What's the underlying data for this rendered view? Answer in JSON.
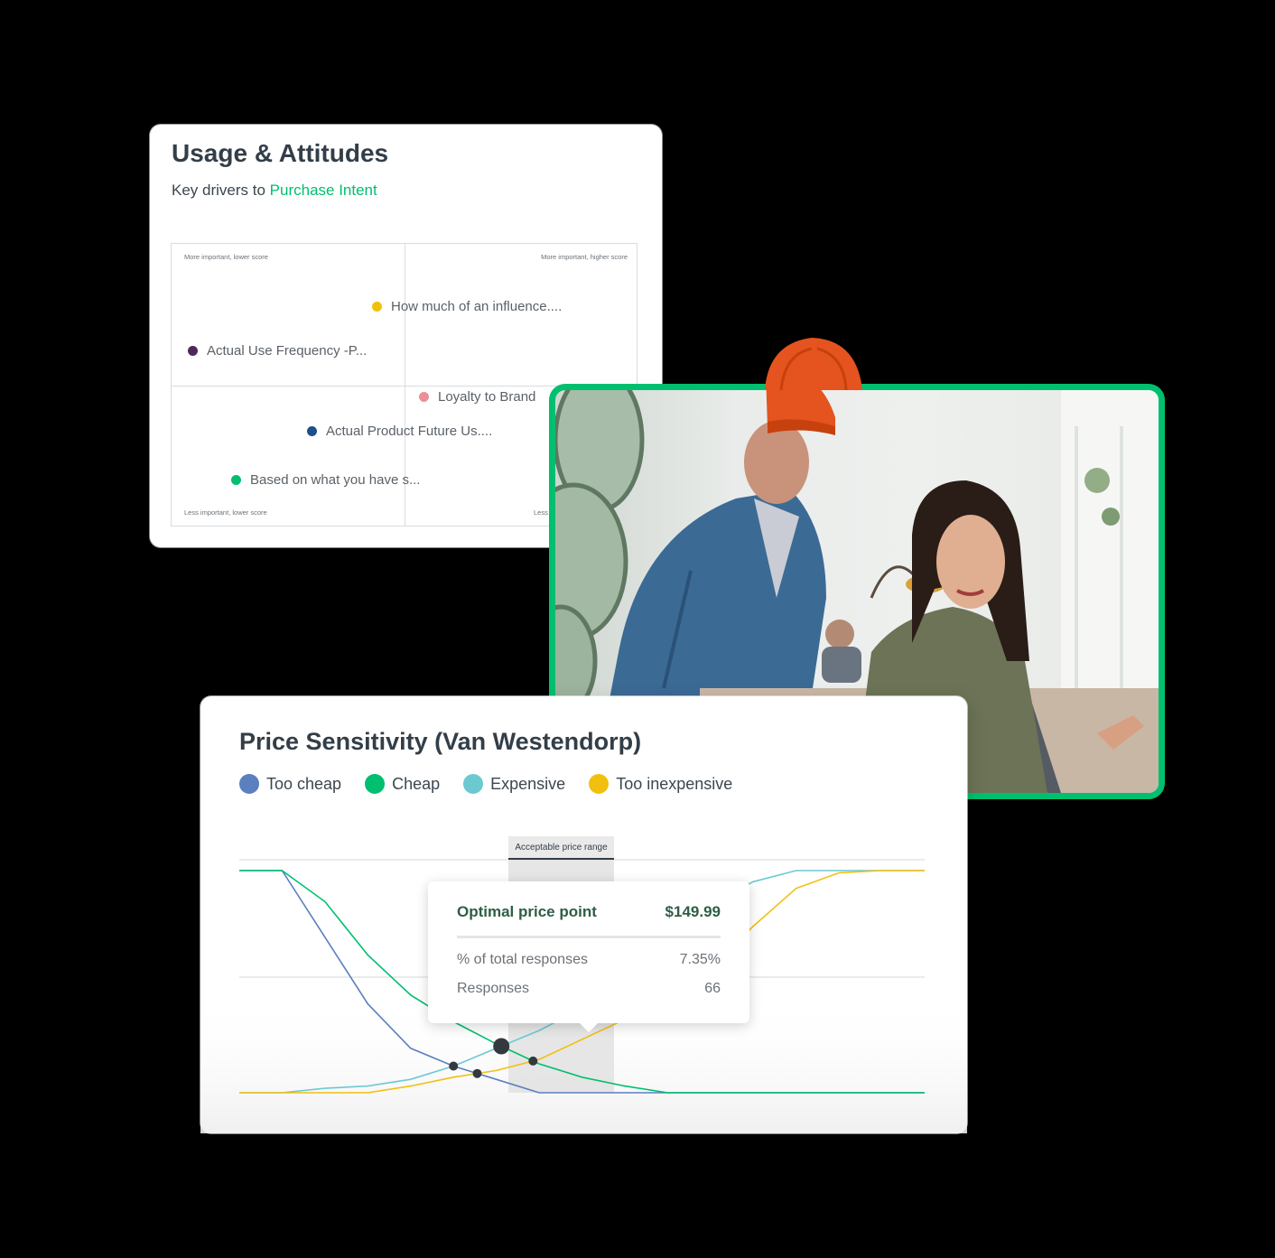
{
  "usage_card": {
    "title": "Usage & Attitudes",
    "subtitle_prefix": "Key drivers to ",
    "subtitle_highlight": "Purchase Intent",
    "corners": {
      "top_left": "More important, lower score",
      "top_right": "More important, higher score",
      "bottom_left": "Less important, lower score",
      "bottom_right": "Less"
    },
    "points": [
      {
        "label": "How much of an influence....",
        "color": "#f1c00f"
      },
      {
        "label": "Actual Use Frequency -P...",
        "color": "#4b2a5a"
      },
      {
        "label": "Loyalty to Brand",
        "color": "#ec8f98"
      },
      {
        "label": "Actual Product Future Us....",
        "color": "#1f4e8a"
      },
      {
        "label": "Based on what you have s...",
        "color": "#00bf6f"
      }
    ]
  },
  "photo": {
    "description_icon": "photo-two-people-laptop",
    "accent_border": "#00bf6f"
  },
  "price_card": {
    "title": "Price Sensitivity (Van Westendorp)",
    "range_label": "Acceptable price range",
    "tooltip": {
      "title": "Optimal price point",
      "price": "$149.99",
      "rows": [
        {
          "label": "% of total responses",
          "value": "7.35%"
        },
        {
          "label": "Responses",
          "value": "66"
        }
      ]
    }
  },
  "chart_data": {
    "type": "line",
    "title": "Price Sensitivity (Van Westendorp)",
    "legend_placement": "top-left",
    "grid": true,
    "ylim": [
      0,
      1
    ],
    "x": [
      0,
      1,
      2,
      3,
      4,
      5,
      6,
      7,
      8,
      9,
      10,
      11,
      12,
      13,
      14,
      15,
      16
    ],
    "series": [
      {
        "name": "Too cheap",
        "color": "#5b7fbf",
        "values": [
          1.0,
          1.0,
          0.7,
          0.4,
          0.2,
          0.12,
          0.06,
          0.0,
          0.0,
          0.0,
          0.0,
          0.0,
          0.0,
          0.0,
          0.0,
          0.0,
          0.0
        ]
      },
      {
        "name": "Cheap",
        "color": "#00bf6f",
        "values": [
          1.0,
          1.0,
          0.86,
          0.62,
          0.44,
          0.32,
          0.22,
          0.13,
          0.07,
          0.03,
          0.0,
          0.0,
          0.0,
          0.0,
          0.0,
          0.0,
          0.0
        ]
      },
      {
        "name": "Expensive",
        "color": "#6cc9d1",
        "values": [
          0.0,
          0.0,
          0.02,
          0.03,
          0.06,
          0.12,
          0.2,
          0.28,
          0.38,
          0.5,
          0.65,
          0.85,
          0.95,
          1.0,
          1.0,
          1.0,
          1.0
        ]
      },
      {
        "name": "Too inexpensive",
        "color": "#f1c00f",
        "values": [
          0.0,
          0.0,
          0.0,
          0.0,
          0.03,
          0.07,
          0.1,
          0.15,
          0.24,
          0.33,
          0.42,
          0.55,
          0.75,
          0.92,
          0.99,
          1.0,
          1.0
        ]
      }
    ]
  }
}
